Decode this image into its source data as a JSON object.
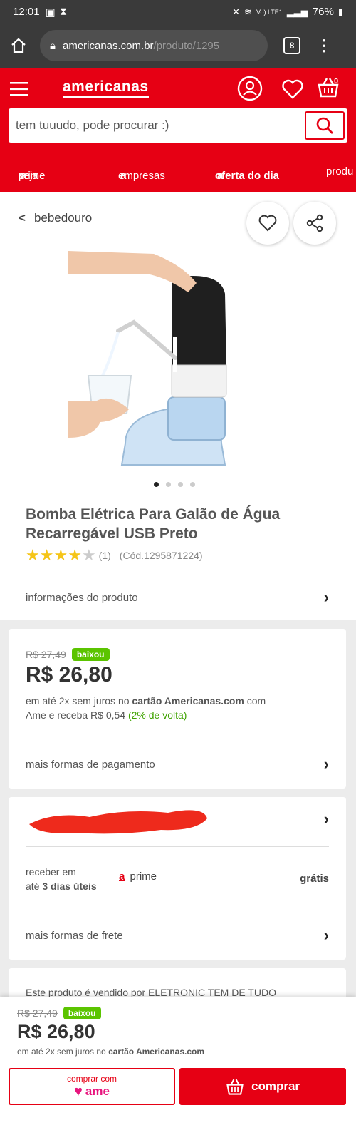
{
  "status_bar": {
    "time": "12:01",
    "battery": "76%",
    "signal": "Vo) LTE1"
  },
  "browser": {
    "url_domain": "americanas.com.br",
    "url_path": "/produto/1295",
    "tab_count": "8"
  },
  "header": {
    "logo": "americanas",
    "cart_count": "0"
  },
  "search": {
    "placeholder": "tem tuuudo, pode procurar :)"
  },
  "nav": {
    "links": [
      "seja",
      "prime",
      "empresas",
      "oferta do dia",
      "produ"
    ],
    "a_mark": "a"
  },
  "breadcrumb": {
    "label": "bebedouro"
  },
  "product": {
    "carousel_dots": 4,
    "title": "Bomba Elétrica Para Galão de Água Recarregável USB Preto",
    "rating": 4,
    "rating_count": "(1)",
    "code": "(Cód.1295871224)",
    "info_link": "informações do produto"
  },
  "pricing": {
    "old_price": "R$ 27,49",
    "badge": "baixou",
    "price": "R$ 26,80",
    "installments_prefix": "em até 2x sem juros no ",
    "installments_card": "cartão Americanas.com",
    "installments_suffix": " com",
    "cashback_prefix": "Ame e receba R$ 0,54 ",
    "cashback_pct": "(2% de volta)",
    "more_payment": "mais formas de pagamento"
  },
  "shipping": {
    "receive_line1": "receber em",
    "receive_line2_prefix": "até ",
    "receive_days": "3 dias úteis",
    "prime_label": "prime",
    "cost": "grátis",
    "more_shipping": "mais formas de frete"
  },
  "seller": {
    "text": "Este produto é vendido por ELETRONIC TEM DE TUDO"
  },
  "bottom_bar": {
    "old_price": "R$ 27,49",
    "badge": "baixou",
    "price": "R$ 26,80",
    "installments_prefix": "em até 2x sem juros no ",
    "installments_card": "cartão Americanas.com",
    "ame_top": "comprar com",
    "ame_brand": "ame",
    "buy_label": "comprar"
  },
  "colors": {
    "brand_red": "#e60014",
    "badge_green": "#5bc400",
    "status_dark": "#3a3a3a"
  }
}
